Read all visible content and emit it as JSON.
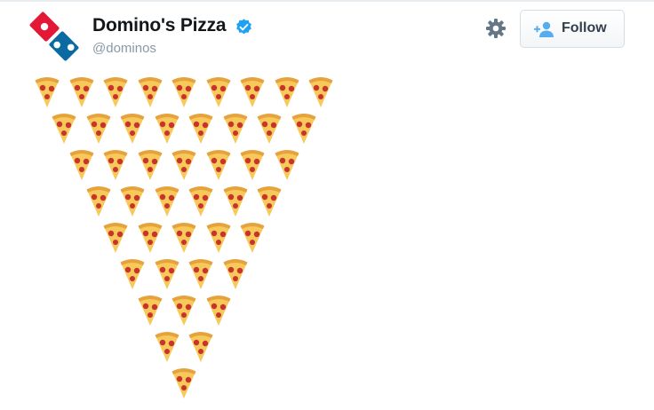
{
  "account": {
    "display_name": "Domino's Pizza",
    "handle": "@dominos",
    "verified": true
  },
  "actions": {
    "follow_label": "Follow"
  },
  "tweet": {
    "emoji": "pizza-icon",
    "rows": [
      9,
      8,
      7,
      6,
      5,
      4,
      3,
      2,
      1
    ]
  },
  "colors": {
    "domino_blue": "#0b6aa2",
    "domino_red": "#e31837",
    "verified_blue": "#1da1f2",
    "follow_icon_blue": "#55acee",
    "crust": "#e6a23c",
    "cheese": "#f6c95a",
    "pepperoni": "#c8342b"
  }
}
